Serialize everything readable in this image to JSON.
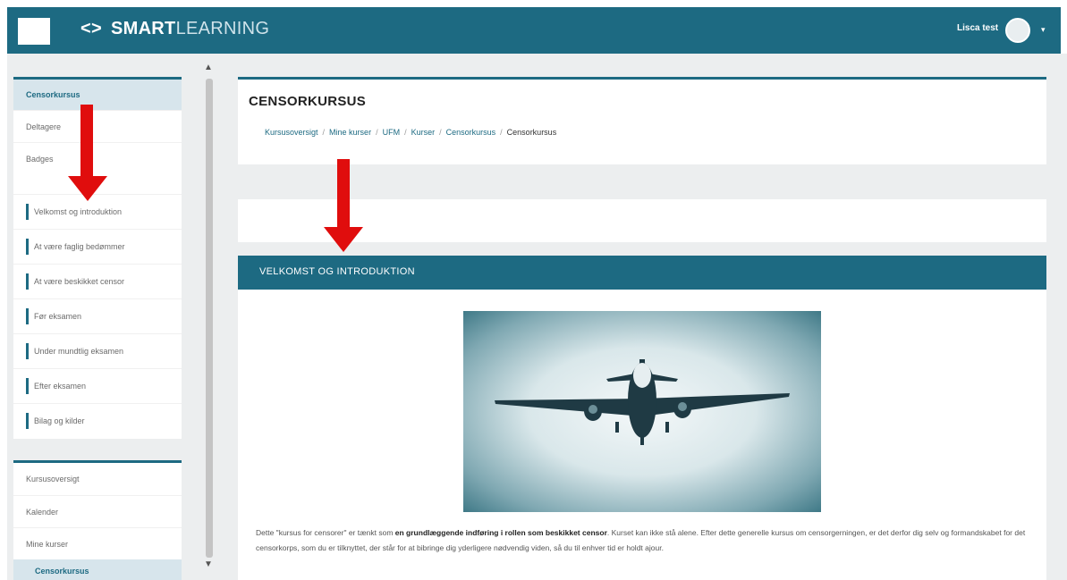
{
  "header": {
    "brand_code_icon": "<>",
    "brand_strong": "SMART",
    "brand_light": "LEARNING",
    "username": "Lisca test",
    "caret": "▾"
  },
  "sidebar": {
    "course_block": {
      "items": [
        {
          "label": "Censorkursus",
          "active": true
        },
        {
          "label": "Deltagere"
        },
        {
          "label": "Badges"
        }
      ],
      "sections": [
        {
          "label": "Velkomst og introduktion"
        },
        {
          "label": "At være faglig bedømmer"
        },
        {
          "label": "At være beskikket censor"
        },
        {
          "label": "Før eksamen"
        },
        {
          "label": "Under mundtlig eksamen"
        },
        {
          "label": "Efter eksamen"
        },
        {
          "label": "Bilag og kilder"
        }
      ]
    },
    "nav_block": {
      "items": [
        {
          "label": "Kursusoversigt"
        },
        {
          "label": "Kalender"
        },
        {
          "label": "Mine kurser"
        },
        {
          "label": "Censorkursus",
          "active": true
        }
      ]
    }
  },
  "page": {
    "title": "CENSORKURSUS",
    "breadcrumb": [
      "Kursusoversigt",
      "Mine kurser",
      "UFM",
      "Kurser",
      "Censorkursus",
      "Censorkursus"
    ],
    "breadcrumb_sep": "/"
  },
  "section": {
    "title": "VELKOMST OG INTRODUKTION",
    "paragraph_pre": "Dette \"kursus for censorer\" er tænkt som ",
    "paragraph_bold": "en grundlæggende indføring i rollen som beskikket censor",
    "paragraph_post": ". Kurset kan ikke stå alene. Efter dette generelle kursus om censorgerningen, er det derfor dig selv og formandskabet for det censorkorps, som du er tilknyttet, der står for at bibringe dig yderligere nødvendig viden, så du til enhver tid er holdt ajour."
  },
  "colors": {
    "brand": "#1d6a82",
    "annotation_arrow": "#e00d0d",
    "sidebar_active_bg": "#d7e5ec"
  },
  "icons": {
    "scroll_up": "▲",
    "scroll_down": "▼"
  }
}
